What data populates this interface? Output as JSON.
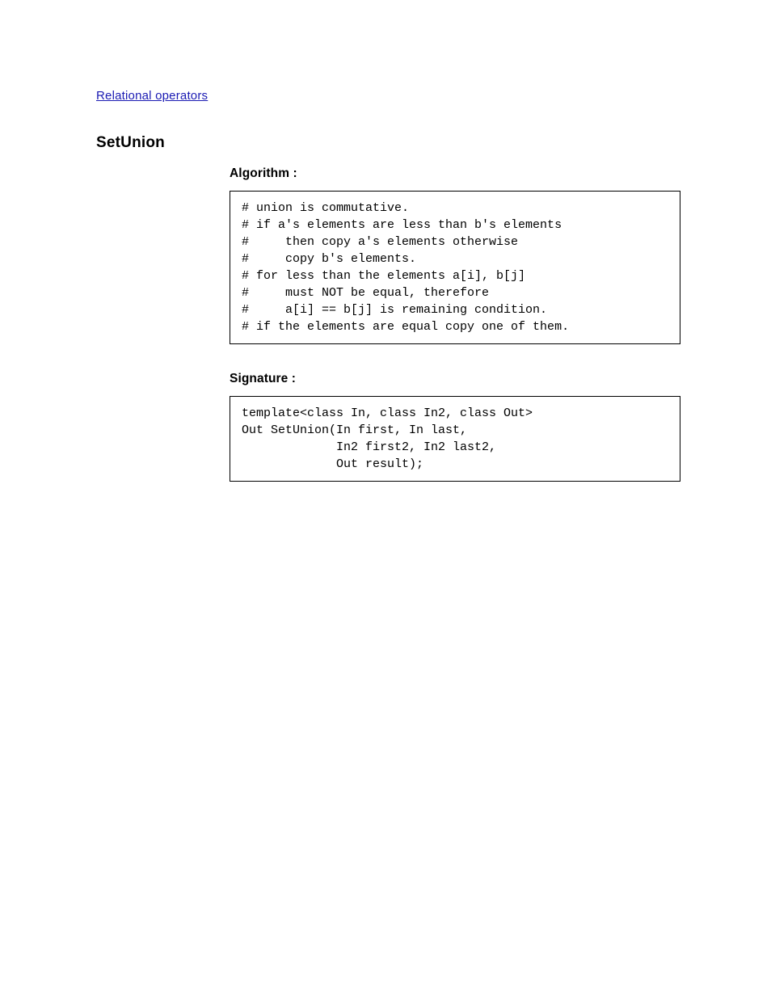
{
  "link": {
    "text": "Relational operators"
  },
  "section": {
    "title": "SetUnion"
  },
  "algorithm": {
    "label": "Algorithm :",
    "code": [
      "# union is commutative.",
      "# if a's elements are less than b's elements",
      "#     then copy a's elements otherwise",
      "#     copy b's elements.",
      "# for less than the elements a[i], b[j]",
      "#     must NOT be equal, therefore",
      "#     a[i] == b[j] is remaining condition.",
      "# if the elements are equal copy one of them."
    ]
  },
  "signature": {
    "label": "Signature :",
    "code": [
      "template<class In, class In2, class Out>",
      "Out SetUnion(In first, In last,",
      "             In2 first2, In2 last2,",
      "             Out result);"
    ]
  }
}
